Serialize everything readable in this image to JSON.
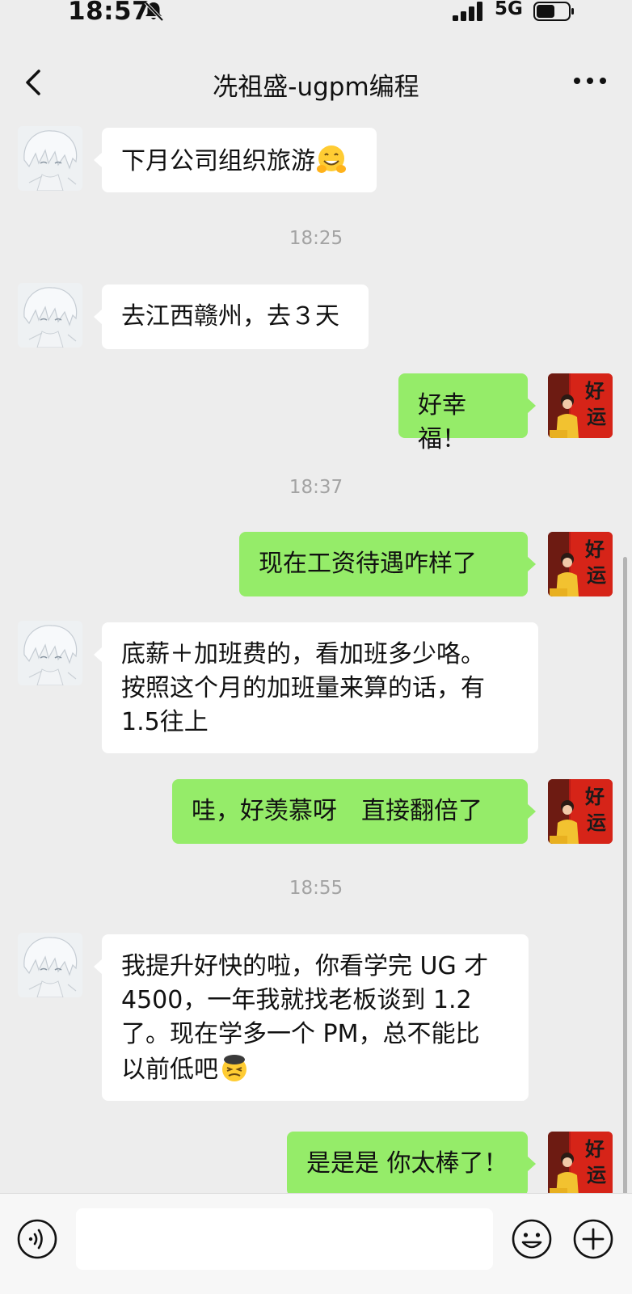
{
  "status_bar": {
    "time": "18:57",
    "network": "5G",
    "icons": [
      "bell-muted-icon",
      "signal-icon",
      "battery-icon"
    ]
  },
  "header": {
    "title": "冼祖盛-ugpm编程",
    "back_icon": "chevron-left-icon",
    "more_icon": "more-dots-icon"
  },
  "messages": [
    {
      "side": "in",
      "text": "下月公司组织旅游",
      "emoji": "hugging-face-emoji"
    },
    {
      "type": "time",
      "text": "18:25"
    },
    {
      "side": "in",
      "text": "去江西赣州，去３天"
    },
    {
      "side": "out",
      "text": "好幸福！"
    },
    {
      "type": "time",
      "text": "18:37"
    },
    {
      "side": "out",
      "text": "现在工资待遇咋样了"
    },
    {
      "side": "in",
      "lines": [
        "底薪＋加班费的，看加班多少咯。",
        "按照这个月的加班量来算的话，有",
        "1.5往上"
      ]
    },
    {
      "side": "out",
      "text": "哇，好羡慕呀　直接翻倍了"
    },
    {
      "type": "time",
      "text": "18:55"
    },
    {
      "side": "in",
      "lines": [
        "我提升好快的啦，你看学完 UG 才",
        "4500，一年我就找老板谈到 1.2",
        "了。现在学多一个 PM，总不能比",
        "以前低吧"
      ],
      "emoji": "smug-face-emoji"
    },
    {
      "side": "out",
      "text": "是是是 你太棒了！"
    }
  ],
  "avatars": {
    "contact": "anime-avatar-white-hair",
    "me": "avatar-red-lucky-banner",
    "me_banner_chars": [
      "好",
      "运"
    ]
  },
  "input_bar": {
    "placeholder": "",
    "icons": [
      "voice-icon",
      "emoji-icon",
      "plus-icon"
    ]
  },
  "colors": {
    "background": "#ededed",
    "outgoing_bubble": "#95ec69",
    "incoming_bubble": "#ffffff",
    "timestamp": "#a3a3a3"
  }
}
